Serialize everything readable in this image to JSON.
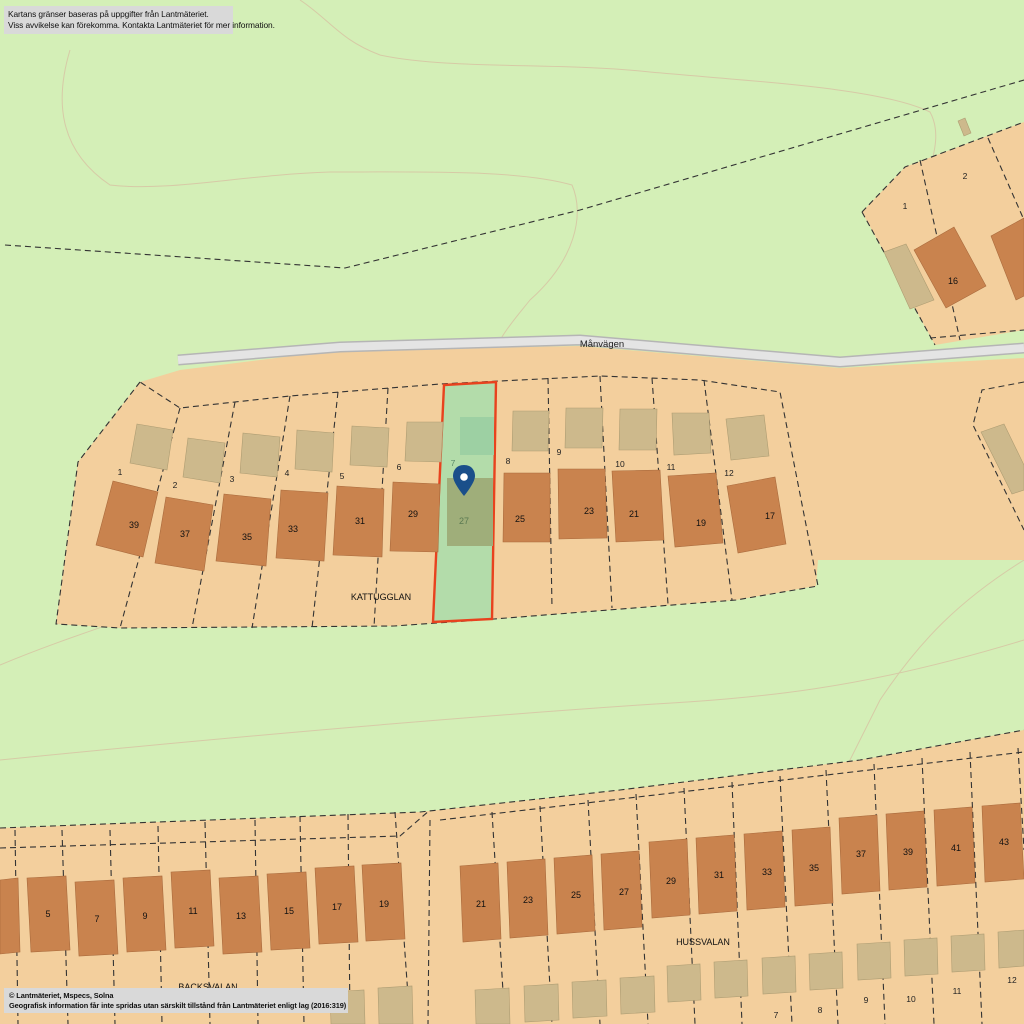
{
  "notice_top": {
    "line1": "Kartans gränser baseras på uppgifter från Lantmäteriet.",
    "line2": "Viss avvikelse kan förekomma. Kontakta Lantmäteriet för mer information."
  },
  "notice_bottom": {
    "line1": "© Lantmäteriet, Mspecs, Solna",
    "line2": "Geografisk information får inte spridas utan särskilt tillstånd från Lantmäteriet enligt lag (2016:319)"
  },
  "street_label": "Månvägen",
  "colors": {
    "park": "#d4efb7",
    "residential": "#f3cf9d",
    "house": "#c9834e",
    "outbuilding": "#cdb98c",
    "selected_fill": "#b3dcaa",
    "selected_border": "#e8421e",
    "pin": "#1a4f8a",
    "road": "#e4e4e4"
  },
  "selected_property": {
    "plot_number": "7",
    "house_number": "27",
    "icon": "location-pin-icon"
  },
  "areas": [
    {
      "name": "KATTUGGLAN",
      "plots": [
        "1",
        "2",
        "3",
        "4",
        "5",
        "6",
        "7",
        "8",
        "9",
        "10",
        "11",
        "12"
      ],
      "houses": [
        "39",
        "37",
        "35",
        "33",
        "31",
        "29",
        "27",
        "25",
        "23",
        "21",
        "19",
        "17"
      ]
    },
    {
      "name": "HUSSVALAN",
      "plots": [
        "7",
        "8",
        "9",
        "10",
        "11",
        "12"
      ],
      "houses": [
        "21",
        "23",
        "25",
        "27",
        "29",
        "31",
        "33",
        "35",
        "37",
        "39",
        "41",
        "43"
      ]
    },
    {
      "name": "BACKSVALAN",
      "plots": [],
      "houses": [
        "5",
        "7",
        "9",
        "11",
        "13",
        "15",
        "17",
        "19"
      ]
    },
    {
      "name": "",
      "plots": [
        "1",
        "2"
      ],
      "houses": [
        "16"
      ]
    }
  ]
}
